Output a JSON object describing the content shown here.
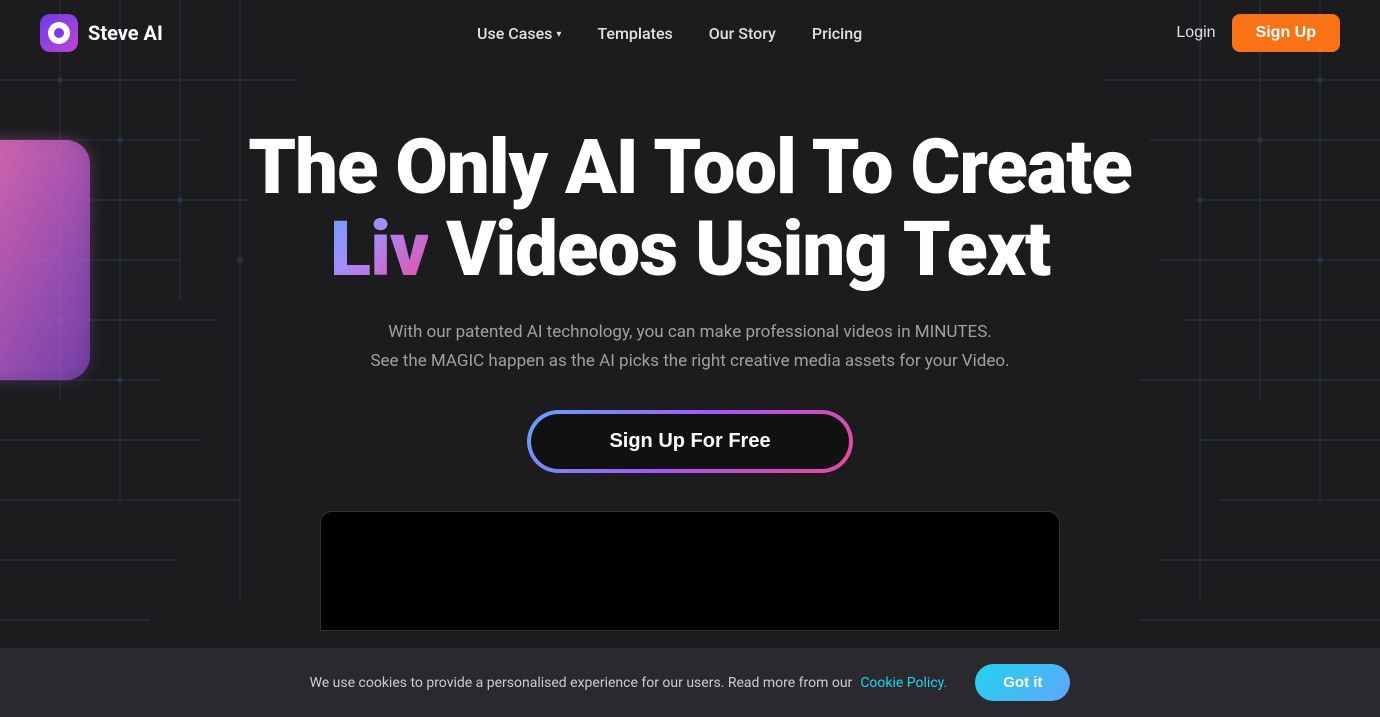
{
  "brand": {
    "logo_text": "Steve AI",
    "logo_icon_label": "steve-ai-logo-icon"
  },
  "nav": {
    "use_cases_label": "Use Cases",
    "templates_label": "Templates",
    "our_story_label": "Our Story",
    "pricing_label": "Pricing",
    "login_label": "Login",
    "signup_label": "Sign Up"
  },
  "hero": {
    "title_part1": "The Only AI Tool To Create",
    "title_liv": "Liv",
    "title_part2": " Videos Using Text",
    "subtitle_line1": "With our patented AI technology, you can make professional videos in MINUTES.",
    "subtitle_line2": "See the MAGIC happen as the AI picks the right creative media assets for your Video.",
    "cta_label": "Sign Up For Free"
  },
  "cookie": {
    "text": "We use cookies to provide a personalised experience for our users. Read more from our",
    "link_text": "Cookie Policy.",
    "button_label": "Got it"
  }
}
